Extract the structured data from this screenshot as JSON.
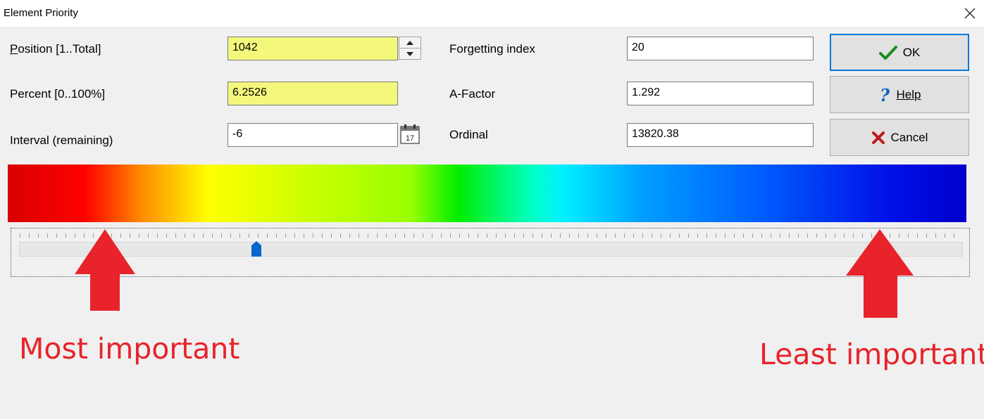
{
  "window": {
    "title": "Element Priority"
  },
  "fields": {
    "position": {
      "label": "Position [1..Total]",
      "value": "1042"
    },
    "percent": {
      "label": "Percent [0..100%]",
      "value": "6.2526"
    },
    "interval": {
      "label": "Interval (remaining)",
      "value": "-6"
    },
    "forgetting_index": {
      "label": "Forgetting index",
      "value": "20"
    },
    "a_factor": {
      "label": "A-Factor",
      "value": "1.292"
    },
    "ordinal": {
      "label": "Ordinal",
      "value": "13820.38"
    }
  },
  "buttons": {
    "ok": {
      "label": "OK",
      "icon": "checkmark-icon",
      "color": "#1a8c1a"
    },
    "help": {
      "label": "Help",
      "icon": "question-icon",
      "color": "#1060c0"
    },
    "cancel": {
      "label": "Cancel",
      "icon": "cross-icon",
      "color": "#c01818"
    }
  },
  "calendar_icon_day": "17",
  "slider": {
    "value_fraction": 0.25
  },
  "annotations": {
    "left": "Most important",
    "right": "Least important",
    "color": "#e8232a"
  },
  "colors": {
    "highlight_field": "#f3f87c",
    "default_button_border": "#0078d7"
  }
}
